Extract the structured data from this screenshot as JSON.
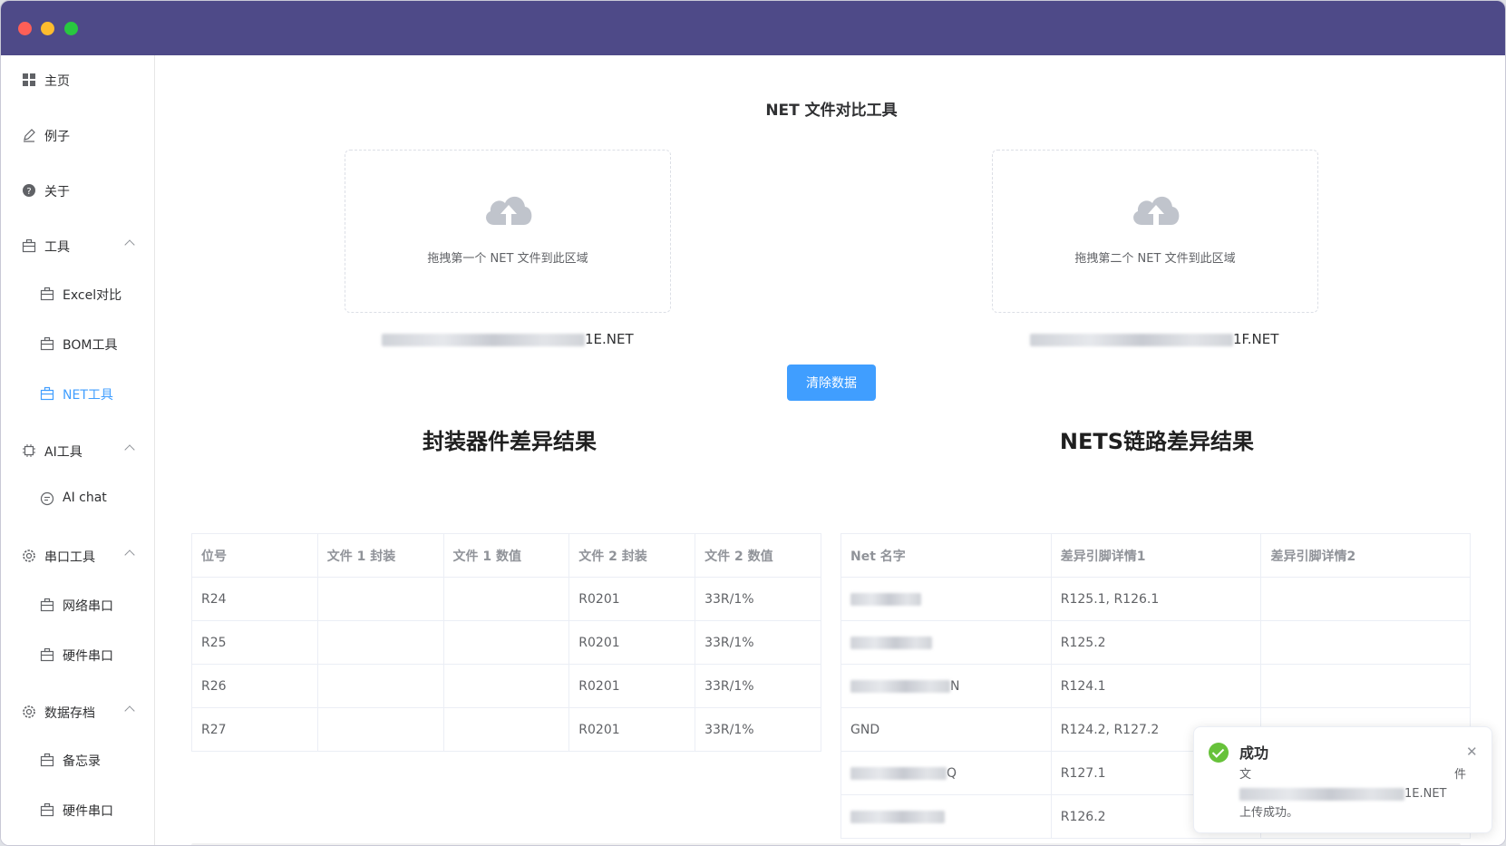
{
  "sidebar": {
    "items": [
      {
        "label": "主页",
        "icon": "grid-icon"
      },
      {
        "label": "例子",
        "icon": "edit-icon"
      },
      {
        "label": "关于",
        "icon": "question-circle-icon"
      },
      {
        "label": "工具",
        "icon": "briefcase-icon",
        "expanded": true
      },
      {
        "label": "Excel对比",
        "icon": "briefcase-icon"
      },
      {
        "label": "BOM工具",
        "icon": "briefcase-icon"
      },
      {
        "label": "NET工具",
        "icon": "briefcase-icon",
        "active": true
      },
      {
        "label": "AI工具",
        "icon": "chip-icon",
        "expanded": true
      },
      {
        "label": "AI chat",
        "icon": "chat-icon"
      },
      {
        "label": "串口工具",
        "icon": "gear-icon",
        "expanded": true
      },
      {
        "label": "网络串口",
        "icon": "briefcase-icon"
      },
      {
        "label": "硬件串口",
        "icon": "briefcase-icon"
      },
      {
        "label": "数据存档",
        "icon": "gear-icon",
        "expanded": true
      },
      {
        "label": "备忘录",
        "icon": "briefcase-icon"
      },
      {
        "label": "硬件串口",
        "icon": "briefcase-icon"
      }
    ]
  },
  "main": {
    "title": "NET 文件对比工具",
    "upload1": {
      "text": "拖拽第一个 NET 文件到此区域",
      "filename_suffix": "1E.NET"
    },
    "upload2": {
      "text": "拖拽第二个 NET 文件到此区域",
      "filename_suffix": "1F.NET"
    },
    "clear_button": "清除数据",
    "section1_title": "封装器件差异结果",
    "section2_title": "NETS链路差异结果",
    "table1": {
      "headers": [
        "位号",
        "文件 1 封装",
        "文件 1 数值",
        "文件 2 封装",
        "文件 2 数值"
      ],
      "rows": [
        [
          "R24",
          "",
          "",
          "R0201",
          "33R/1%"
        ],
        [
          "R25",
          "",
          "",
          "R0201",
          "33R/1%"
        ],
        [
          "R26",
          "",
          "",
          "R0201",
          "33R/1%"
        ],
        [
          "R27",
          "",
          "",
          "R0201",
          "33R/1%"
        ]
      ]
    },
    "table2": {
      "headers": [
        "Net 名字",
        "差异引脚详情1",
        "差异引脚详情2"
      ],
      "rows": [
        [
          "",
          "R125.1, R126.1",
          ""
        ],
        [
          "",
          "R125.2",
          ""
        ],
        [
          "N",
          "R124.1",
          ""
        ],
        [
          "GND",
          "R124.2, R127.2",
          ""
        ],
        [
          "Q",
          "R127.1",
          ""
        ],
        [
          "",
          "R126.2",
          ""
        ]
      ]
    }
  },
  "toast": {
    "title": "成功",
    "line1_left": "文",
    "line1_right": "件",
    "filename_suffix": "1E.NET",
    "message": "上传成功。"
  },
  "colors": {
    "titlebar": "#4e4a88",
    "accent": "#409eff",
    "success": "#67c23a"
  }
}
